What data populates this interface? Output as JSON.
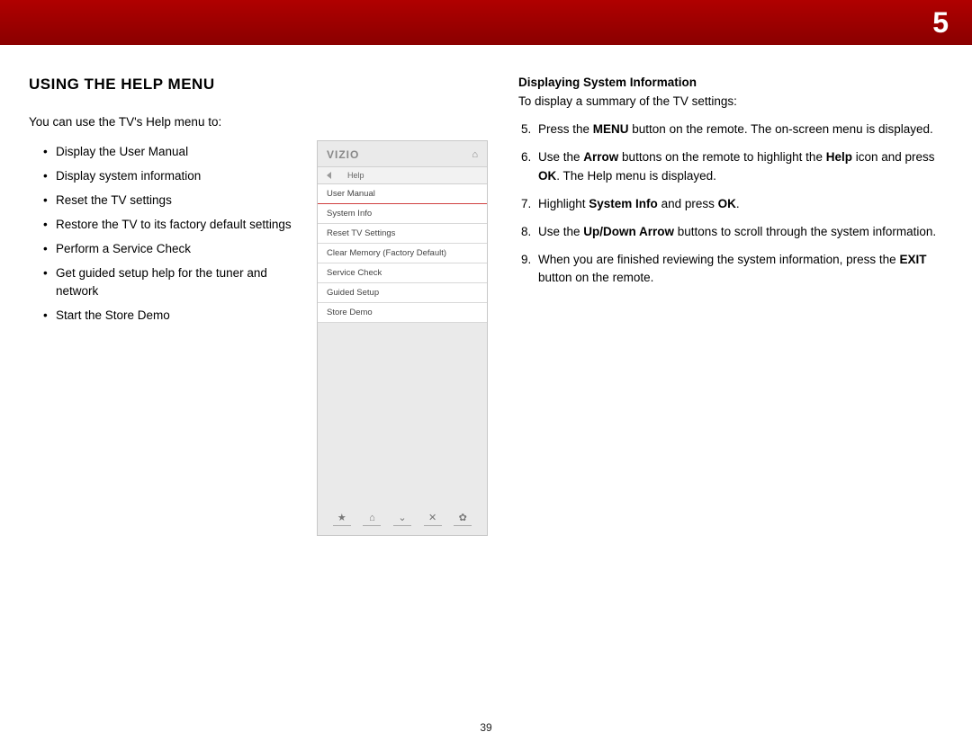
{
  "chapter_number": "5",
  "page_number": "39",
  "left": {
    "title": "USING THE HELP MENU",
    "intro": "You can use the TV's Help menu to:",
    "bullets": [
      "Display the User Manual",
      "Display system information",
      "Reset the TV settings",
      "Restore the TV to its factory default settings",
      "Perform a Service Check",
      "Get guided setup help for the tuner and network",
      "Start the Store Demo"
    ]
  },
  "tv": {
    "logo": "VIZIO",
    "breadcrumb": "Help",
    "items": [
      "User Manual",
      "System Info",
      "Reset TV Settings",
      "Clear Memory (Factory Default)",
      "Service Check",
      "Guided Setup",
      "Store Demo"
    ],
    "footer_icons": [
      "★",
      "⌂",
      "⌄",
      "✕",
      "✿"
    ]
  },
  "right": {
    "title": "Displaying System Information",
    "intro": "To display a summary of the TV settings:",
    "steps": [
      {
        "n": 5,
        "html": "Press the <b>MENU</b> button on the remote. The on-screen menu is displayed."
      },
      {
        "n": 6,
        "html": "Use the <b>Arrow</b> buttons on the remote to highlight the <b>Help</b> icon and press <b>OK</b>. The Help menu is displayed."
      },
      {
        "n": 7,
        "html": "Highlight <b>System Info</b> and press <b>OK</b>."
      },
      {
        "n": 8,
        "html": "Use the <b>Up/Down Arrow</b> buttons to scroll through the system information."
      },
      {
        "n": 9,
        "html": "When you are finished reviewing the system information, press the <b>EXIT</b> button on the remote."
      }
    ]
  }
}
